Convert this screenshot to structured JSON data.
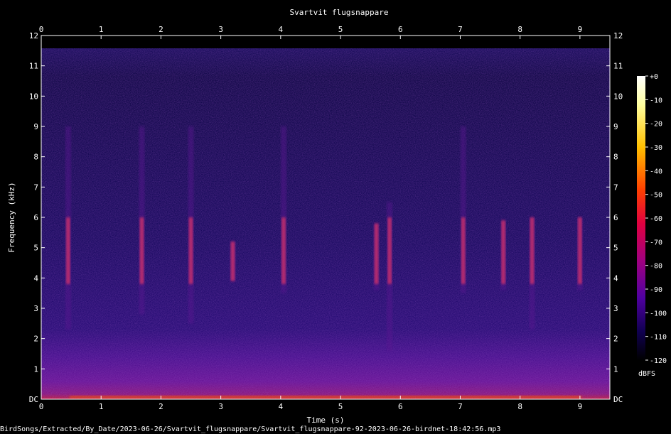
{
  "chart_data": {
    "type": "heatmap",
    "title": "Svartvit flugsnappare",
    "xlabel": "Time (s)",
    "ylabel": "Frequency (kHz)",
    "xlim": [
      0,
      9.5
    ],
    "ylim": [
      0,
      12
    ],
    "x_ticks": [
      "0",
      "1",
      "2",
      "3",
      "4",
      "5",
      "6",
      "7",
      "8",
      "9"
    ],
    "y_ticks": [
      "DC",
      "1",
      "2",
      "3",
      "4",
      "5",
      "6",
      "7",
      "8",
      "9",
      "10",
      "11",
      "12"
    ],
    "colorbar": {
      "label": "dBFS",
      "ticks": [
        "+0",
        "-10",
        "-20",
        "-30",
        "-40",
        "-50",
        "-60",
        "-70",
        "-80",
        "-90",
        "-100",
        "-110",
        "-120"
      ],
      "range": [
        -120,
        0
      ]
    },
    "calls": [
      {
        "t": 0.45,
        "f_low": 2.3,
        "f_high": 9.0
      },
      {
        "t": 1.68,
        "f_low": 2.8,
        "f_high": 9.0
      },
      {
        "t": 2.5,
        "f_low": 2.5,
        "f_high": 9.0
      },
      {
        "t": 3.2,
        "f_low": 3.9,
        "f_high": 5.2
      },
      {
        "t": 4.05,
        "f_low": 3.5,
        "f_high": 9.0
      },
      {
        "t": 5.6,
        "f_low": 3.6,
        "f_high": 5.8
      },
      {
        "t": 5.82,
        "f_low": 1.6,
        "f_high": 6.5
      },
      {
        "t": 7.05,
        "f_low": 3.5,
        "f_high": 9.0
      },
      {
        "t": 7.72,
        "f_low": 3.6,
        "f_high": 5.9
      },
      {
        "t": 8.2,
        "f_low": 2.3,
        "f_high": 6.0
      },
      {
        "t": 9.0,
        "f_low": 3.6,
        "f_high": 6.0
      }
    ],
    "colors": {
      "background": "#000000",
      "noise_floor": "#1a0a5e",
      "low_band": "#5a1490",
      "call": "#d0306a",
      "hot": "#ff5a00"
    }
  },
  "footer": {
    "filepath": "BirdSongs/Extracted/By_Date/2023-06-26/Svartvit_flugsnappare/Svartvit_flugsnappare-92-2023-06-26-birdnet-18:42:56.mp3"
  }
}
